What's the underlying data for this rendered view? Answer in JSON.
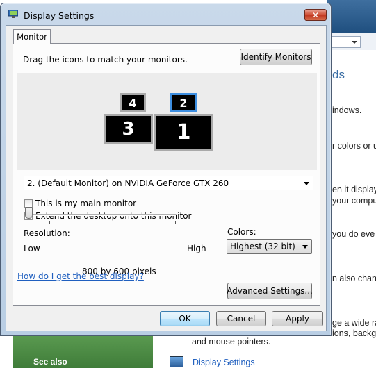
{
  "window": {
    "title": "Display Settings",
    "close_label": "✕"
  },
  "tabs": [
    {
      "label": "Monitor"
    }
  ],
  "monitor_tab": {
    "instruction": "Drag the icons to match your monitors.",
    "identify_button": "Identify Monitors",
    "monitors": [
      {
        "number": "1",
        "selected": false
      },
      {
        "number": "2",
        "selected": true
      },
      {
        "number": "3",
        "selected": false
      },
      {
        "number": "4",
        "selected": false
      }
    ],
    "monitor_select": "2. (Default Monitor) on NVIDIA GeForce GTX 260",
    "main_monitor_checkbox": {
      "label": "This is my main monitor",
      "checked": false
    },
    "extend_checkbox": {
      "label": "Extend the desktop onto this monitor",
      "checked": true,
      "mark": "✓"
    },
    "resolution": {
      "label": "Resolution:",
      "low_label": "Low",
      "high_label": "High",
      "value_text": "800 by 600 pixels",
      "slider_level": 0
    },
    "colors": {
      "label": "Colors:",
      "selected": "Highest (32 bit)"
    },
    "help_link": "How do I get the best display?",
    "advanced_button": "Advanced Settings..."
  },
  "footer": {
    "ok_button": "OK",
    "cancel_button": "Cancel",
    "apply_button": "Apply"
  },
  "background_window": {
    "heading": "ds",
    "lines": [
      "indows.",
      "r colors or u",
      "en it display",
      "your compu",
      "you do eve",
      "n also chang",
      "ge a wide ra",
      "ions, backgr"
    ],
    "lower_text": "and mouse pointers.",
    "see_also": "See also",
    "link": "Display Settings"
  }
}
